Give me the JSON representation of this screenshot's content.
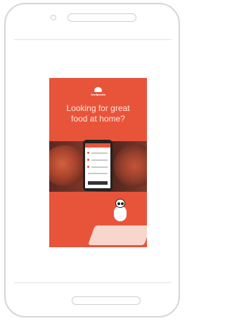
{
  "poster": {
    "brand_name": "foodpanda",
    "headline": "Looking for great\nfood at home?"
  },
  "colors": {
    "brand_accent": "#e8543a",
    "phone_frame": "#d6d6d6"
  },
  "icons": {
    "mascot": "panda-mascot-icon",
    "logo": "foodpanda-logo-icon"
  }
}
